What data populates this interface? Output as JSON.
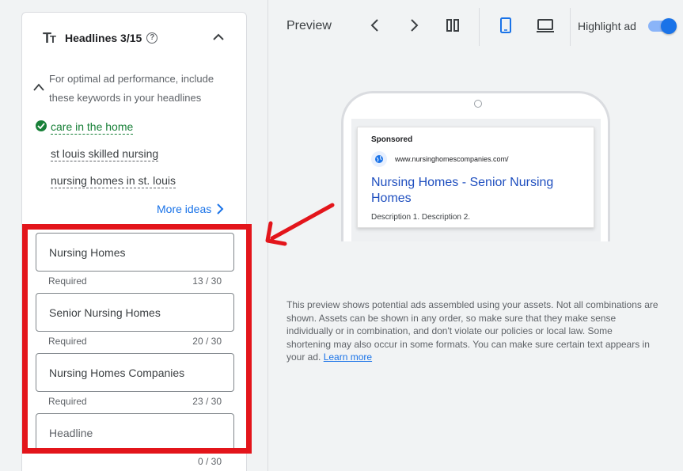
{
  "left_panel": {
    "title": "Headlines 3/15",
    "suggestion": {
      "text": "For optimal ad performance, include these keywords in your headlines",
      "keywords": [
        {
          "label": "care in the home",
          "status": "included"
        },
        {
          "label": "st louis skilled nursing",
          "status": "suggested"
        },
        {
          "label": "nursing homes in st. louis",
          "status": "suggested"
        }
      ],
      "more_ideas": "More ideas"
    },
    "headlines": [
      {
        "value": "Nursing Homes",
        "placeholder": "",
        "helper": "Required",
        "count": "13 / 30"
      },
      {
        "value": "Senior Nursing Homes",
        "placeholder": "",
        "helper": "Required",
        "count": "20 / 30"
      },
      {
        "value": "Nursing Homes Companies",
        "placeholder": "",
        "helper": "Required",
        "count": "23 / 30"
      },
      {
        "value": "",
        "placeholder": "Headline",
        "helper": "",
        "count": "0 / 30"
      }
    ]
  },
  "toolbar": {
    "preview_label": "Preview",
    "highlight_label": "Highlight ad",
    "highlight_on": true
  },
  "ad_preview": {
    "sponsored": "Sponsored",
    "url": "www.nursinghomescompanies.com/",
    "headline": "Nursing Homes - Senior Nursing Homes",
    "description": "Description 1. Description 2."
  },
  "disclaimer": {
    "text": "This preview shows potential ads assembled using your assets. Not all combinations are shown. Assets can be shown in any order, so make sure that they make sense individually or in combination, and don't violate our policies or local law. Some shortening may also occur in some formats. You can make sure certain text appears in your ad.",
    "link": "Learn more"
  },
  "colors": {
    "accent": "#1a73e8",
    "success": "#188038",
    "annotation": "#e3151b",
    "ad_headline": "#1f4fbf"
  },
  "icons": [
    "text-tt-icon",
    "help-icon",
    "chevron-up-icon",
    "check-circle-icon",
    "chevron-right-icon",
    "chevron-left-icon",
    "columns-icon",
    "mobile-icon",
    "laptop-icon",
    "globe-icon",
    "annotation-arrow"
  ]
}
